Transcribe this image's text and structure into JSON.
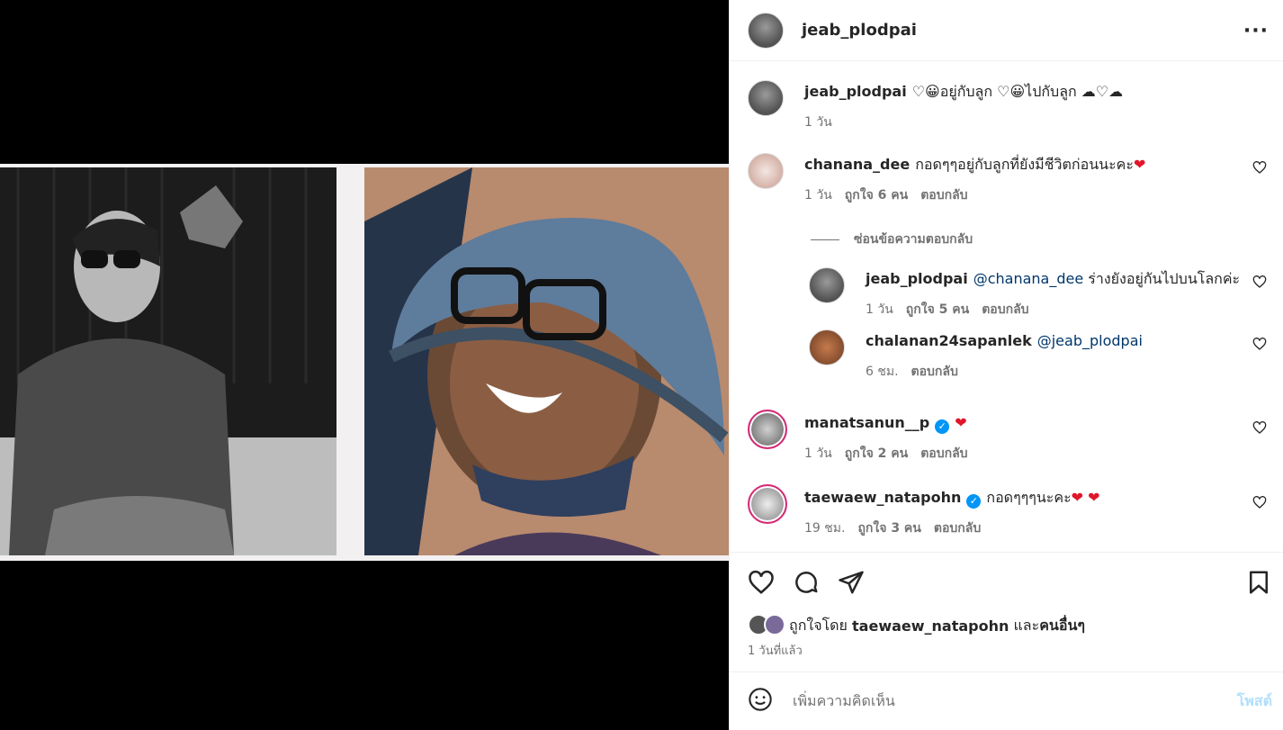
{
  "post": {
    "author": "jeab_plodpai",
    "caption_user": "jeab_plodpai",
    "caption": "♡😀อยู่กับลูก ♡😀ไปกับลูก ☁♡☁",
    "caption_time": "1 วัน"
  },
  "replies_toggle": "ซ่อนข้อความตอบกลับ",
  "comments": [
    {
      "user": "chanana_dee",
      "text": "กอดๆๆอยู่กับลูกที่ยังมีชีวิตก่อนนะคะ",
      "emoji": "❤",
      "time": "1 วัน",
      "likes": "ถูกใจ 6 คน",
      "reply": "ตอบกลับ"
    },
    {
      "user": "jeab_plodpai",
      "mention": "@chanana_dee",
      "text": "ร่างยังอยู่กันไปบนโลกค่ะ",
      "time": "1 วัน",
      "likes": "ถูกใจ 5 คน",
      "reply": "ตอบกลับ"
    },
    {
      "user": "chalanan24sapanlek",
      "mention": "@jeab_plodpai",
      "time": "6 ชม.",
      "reply": "ตอบกลับ"
    },
    {
      "user": "manatsanun__p",
      "verified": "✓",
      "emoji": "❤",
      "time": "1 วัน",
      "likes": "ถูกใจ 2 คน",
      "reply": "ตอบกลับ"
    },
    {
      "user": "taewaew_natapohn",
      "verified": "✓",
      "text": "กอดๆๆๆนะคะ",
      "emoji": "❤ ❤",
      "time": "19 ชม.",
      "likes": "ถูกใจ 3 คน",
      "reply": "ตอบกลับ"
    }
  ],
  "likes": {
    "prefix": "ถูกใจโดย",
    "user": "taewaew_natapohn",
    "and": "และ",
    "others": "คนอื่นๆ"
  },
  "timestamp": "1 วันที่แล้ว",
  "composer": {
    "placeholder": "เพิ่มความคิดเห็น",
    "post": "โพสต์"
  },
  "more_label": "···"
}
